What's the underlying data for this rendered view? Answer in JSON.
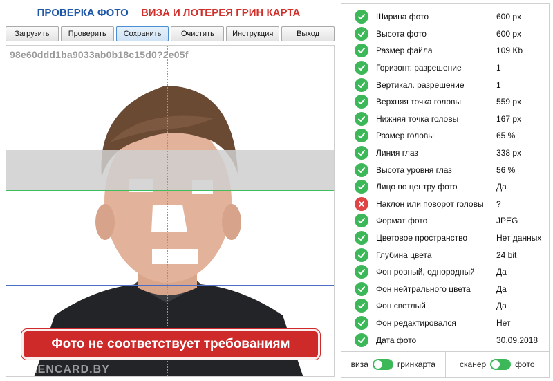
{
  "header": {
    "title_left": "ПРОВЕРКА ФОТО",
    "title_right": "ВИЗА И ЛОТЕРЕЯ ГРИН КАРТА"
  },
  "toolbar": {
    "load": "Загрузить",
    "check": "Проверить",
    "save": "Сохранить",
    "clear": "Очистить",
    "instructions": "Инструкция",
    "exit": "Выход"
  },
  "photo": {
    "hash": "98e60ddd1ba9033ab0b18c15d0?2e05f",
    "warning": "Фото не соответствует требованиям",
    "watermark": "GREENCARD.BY"
  },
  "checks": [
    {
      "label": "Ширина фото",
      "value": "600 px",
      "status": "ok"
    },
    {
      "label": "Высота фото",
      "value": "600 px",
      "status": "ok"
    },
    {
      "label": "Размер файла",
      "value": "109 Kb",
      "status": "ok"
    },
    {
      "label": "Горизонт. разрешение",
      "value": "1",
      "status": "ok"
    },
    {
      "label": "Вертикал. разрешение",
      "value": "1",
      "status": "ok"
    },
    {
      "label": "Верхняя точка головы",
      "value": "559 px",
      "status": "ok"
    },
    {
      "label": "Нижняя точка головы",
      "value": "167 px",
      "status": "ok"
    },
    {
      "label": "Размер головы",
      "value": "65 %",
      "status": "ok"
    },
    {
      "label": "Линия глаз",
      "value": "338 px",
      "status": "ok"
    },
    {
      "label": "Высота уровня глаз",
      "value": "56 %",
      "status": "ok"
    },
    {
      "label": "Лицо по центру фото",
      "value": "Да",
      "status": "ok"
    },
    {
      "label": "Наклон или поворот головы",
      "value": "?",
      "status": "bad"
    },
    {
      "label": "Формат фото",
      "value": "JPEG",
      "status": "ok"
    },
    {
      "label": "Цветовое пространство",
      "value": "Нет данных",
      "status": "ok"
    },
    {
      "label": "Глубина цвета",
      "value": "24 bit",
      "status": "ok"
    },
    {
      "label": "Фон ровный, однородный",
      "value": "Да",
      "status": "ok"
    },
    {
      "label": "Фон нейтрального цвета",
      "value": "Да",
      "status": "ok"
    },
    {
      "label": "Фон светлый",
      "value": "Да",
      "status": "ok"
    },
    {
      "label": "Фон редактировался",
      "value": "Нет",
      "status": "ok"
    },
    {
      "label": "Дата фото",
      "value": "30.09.2018",
      "status": "ok"
    }
  ],
  "footer": {
    "visa_label": "виза",
    "greencard_label": "гринкарта",
    "scanner_label": "сканер",
    "photo_label": "фото"
  }
}
